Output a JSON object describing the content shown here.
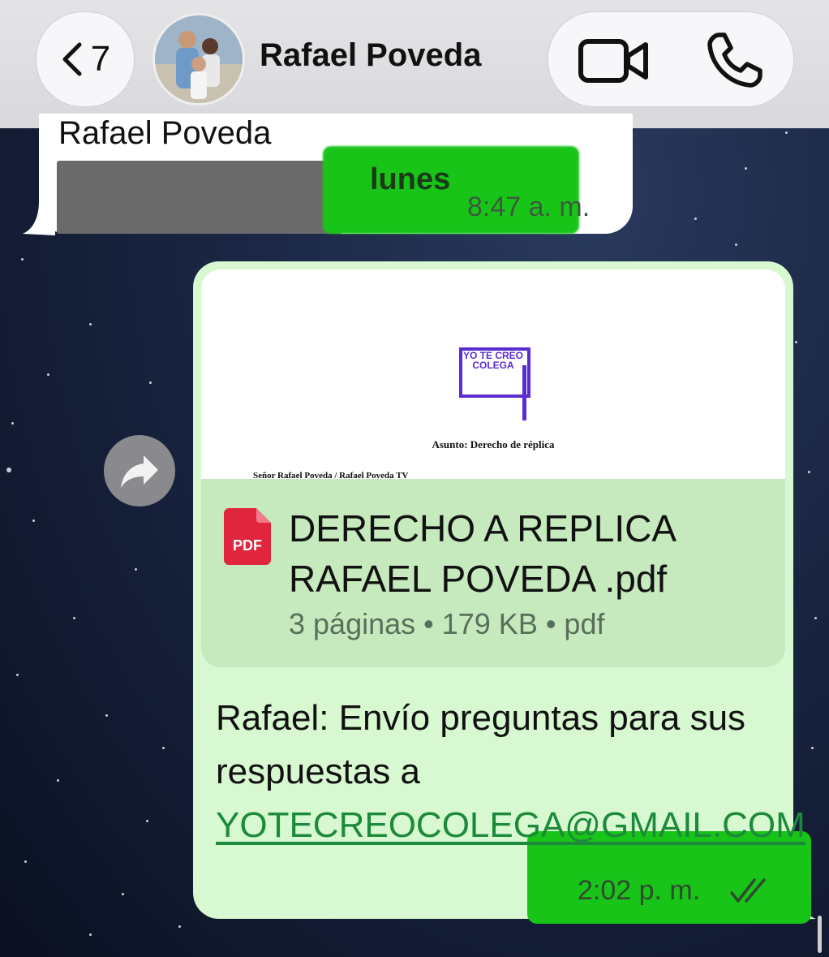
{
  "header": {
    "back_count": "7",
    "contact_name": "Rafael Poveda"
  },
  "previous_message": {
    "sender_name": "Rafael Poveda",
    "date_label": "lunes",
    "time": "8:47 a. m."
  },
  "document_message": {
    "preview": {
      "logo_text": "YO TE CREO COLEGA",
      "subject_line": "Asunto: Derecho de réplica",
      "greeting_line": "Señor Rafael Poveda / Rafael Poveda TV"
    },
    "file_icon_label": "PDF",
    "file_name": "DERECHO A REPLICA RAFAEL POVEDA .pdf",
    "file_meta": "3 páginas • 179 KB • pdf",
    "caption_text": "Rafael: Envío preguntas para sus respuestas a ",
    "caption_link": "YOTECREOCOLEGA@GMAIL.COM",
    "time": "2:02 p. m."
  },
  "colors": {
    "outgoing_bubble": "#d7f8d0",
    "file_card": "#c6e9be",
    "highlight": "#19c419",
    "link": "#1c8a3a",
    "logo_purple": "#5b2ccf",
    "pdf_red": "#e0263f"
  },
  "icons": [
    "chevron-left-icon",
    "video-camera-icon",
    "phone-icon",
    "forward-arrow-icon",
    "pdf-file-icon",
    "double-check-icon"
  ]
}
